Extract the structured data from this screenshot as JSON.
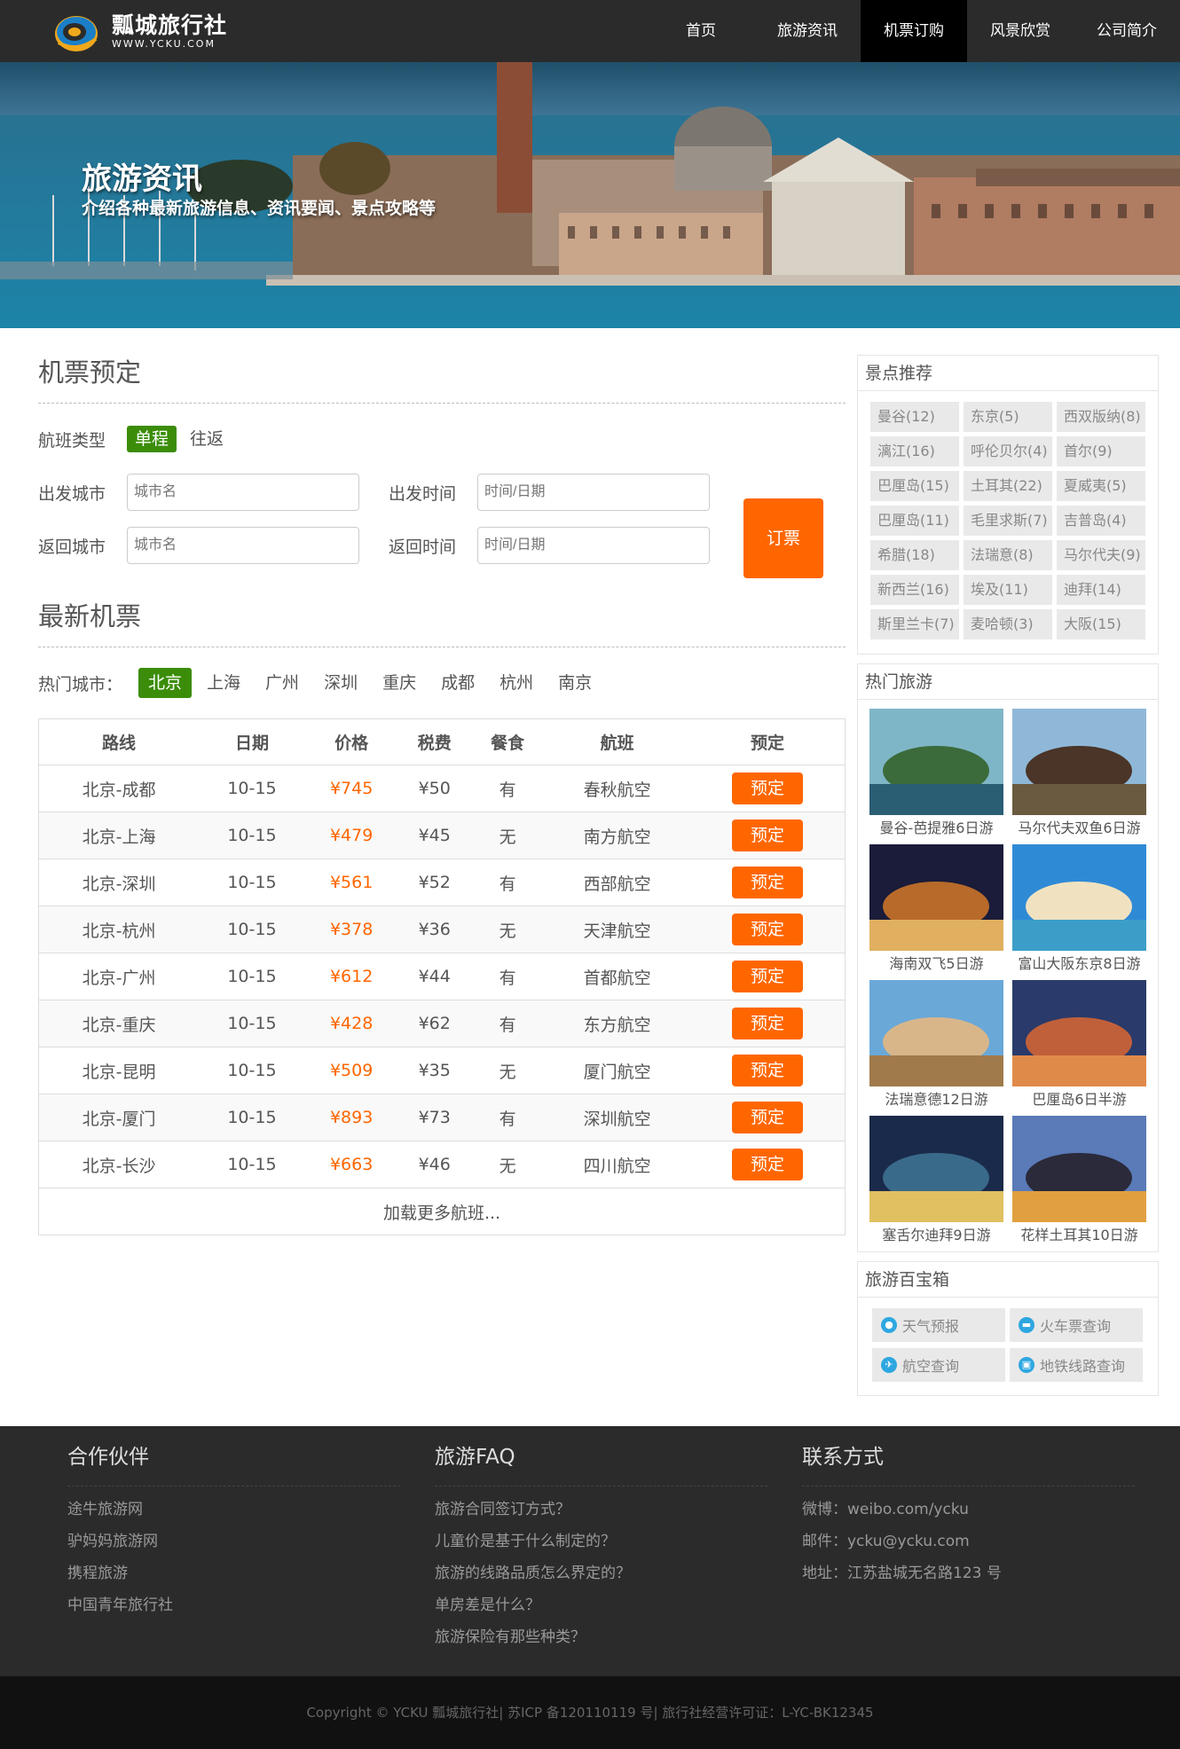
{
  "brand": {
    "name": "瓢城旅行社",
    "url": "WWW.YCKU.COM"
  },
  "nav": [
    {
      "label": "首页"
    },
    {
      "label": "旅游资讯"
    },
    {
      "label": "机票订购",
      "active": true
    },
    {
      "label": "风景欣赏"
    },
    {
      "label": "公司简介"
    }
  ],
  "banner": {
    "title": "旅游资讯",
    "subtitle": "介绍各种最新旅游信息、资讯要闻、景点攻略等"
  },
  "booking": {
    "title": "机票预定",
    "flight_type_label": "航班类型",
    "flight_types": [
      "单程",
      "往返"
    ],
    "depart_city_label": "出发城市",
    "depart_city_placeholder": "城市名",
    "depart_time_label": "出发时间",
    "depart_time_placeholder": "时间/日期",
    "return_city_label": "返回城市",
    "return_city_placeholder": "城市名",
    "return_time_label": "返回时间",
    "return_time_placeholder": "时间/日期",
    "submit_label": "订票"
  },
  "latest": {
    "title": "最新机票",
    "hot_label": "热门城市：",
    "cities": [
      "北京",
      "上海",
      "广州",
      "深圳",
      "重庆",
      "成都",
      "杭州",
      "南京"
    ],
    "columns": [
      "路线",
      "日期",
      "价格",
      "税费",
      "餐食",
      "航班",
      "预定"
    ],
    "rows": [
      {
        "route": "北京-成都",
        "date": "10-15",
        "price": "¥745",
        "tax": "¥50",
        "meal": "有",
        "airline": "春秋航空",
        "action": "预定"
      },
      {
        "route": "北京-上海",
        "date": "10-15",
        "price": "¥479",
        "tax": "¥45",
        "meal": "无",
        "airline": "南方航空",
        "action": "预定"
      },
      {
        "route": "北京-深圳",
        "date": "10-15",
        "price": "¥561",
        "tax": "¥52",
        "meal": "有",
        "airline": "西部航空",
        "action": "预定"
      },
      {
        "route": "北京-杭州",
        "date": "10-15",
        "price": "¥378",
        "tax": "¥36",
        "meal": "无",
        "airline": "天津航空",
        "action": "预定"
      },
      {
        "route": "北京-广州",
        "date": "10-15",
        "price": "¥612",
        "tax": "¥44",
        "meal": "有",
        "airline": "首都航空",
        "action": "预定"
      },
      {
        "route": "北京-重庆",
        "date": "10-15",
        "price": "¥428",
        "tax": "¥62",
        "meal": "有",
        "airline": "东方航空",
        "action": "预定"
      },
      {
        "route": "北京-昆明",
        "date": "10-15",
        "price": "¥509",
        "tax": "¥35",
        "meal": "无",
        "airline": "厦门航空",
        "action": "预定"
      },
      {
        "route": "北京-厦门",
        "date": "10-15",
        "price": "¥893",
        "tax": "¥73",
        "meal": "有",
        "airline": "深圳航空",
        "action": "预定"
      },
      {
        "route": "北京-长沙",
        "date": "10-15",
        "price": "¥663",
        "tax": "¥46",
        "meal": "无",
        "airline": "四川航空",
        "action": "预定"
      }
    ],
    "load_more": "加载更多航班..."
  },
  "sidebar": {
    "spots_title": "景点推荐",
    "spots": [
      "曼谷(12)",
      "东京(5)",
      "西双版纳(8)",
      "漓江(16)",
      "呼伦贝尔(4)",
      "首尔(9)",
      "巴厘岛(15)",
      "土耳其(22)",
      "夏威夷(5)",
      "巴厘岛(11)",
      "毛里求斯(7)",
      "吉普岛(4)",
      "希腊(18)",
      "法瑞意(8)",
      "马尔代夫(9)",
      "新西兰(16)",
      "埃及(11)",
      "迪拜(14)",
      "斯里兰卡(7)",
      "麦哈顿(3)",
      "大阪(15)"
    ],
    "tours_title": "热门旅游",
    "tours": [
      {
        "caption": "曼谷-芭提雅6日游",
        "icon": "bay-islands-photo"
      },
      {
        "caption": "马尔代夫双鱼6日游",
        "icon": "temple-gate-photo"
      },
      {
        "caption": "海南双飞5日游",
        "icon": "night-temple-photo"
      },
      {
        "caption": "富山大阪东京8日游",
        "icon": "beach-huts-photo"
      },
      {
        "caption": "法瑞意德12日游",
        "icon": "beach-hat-photo"
      },
      {
        "caption": "巴厘岛6日半游",
        "icon": "aqueduct-photo"
      },
      {
        "caption": "塞舌尔迪拜9日游",
        "icon": "harbor-night-photo"
      },
      {
        "caption": "花样土耳其10日游",
        "icon": "city-tower-photo"
      }
    ],
    "tools_title": "旅游百宝箱",
    "tools": [
      {
        "label": "天气预报",
        "icon": "location-pin-icon"
      },
      {
        "label": "火车票查询",
        "icon": "train-icon"
      },
      {
        "label": "航空查询",
        "icon": "plane-icon"
      },
      {
        "label": "地铁线路查询",
        "icon": "subway-icon"
      }
    ]
  },
  "footer": {
    "partners_title": "合作伙伴",
    "partners": [
      "途牛旅游网",
      "驴妈妈旅游网",
      "携程旅游",
      "中国青年旅行社"
    ],
    "faq_title": "旅游FAQ",
    "faq": [
      "旅游合同签订方式？",
      "儿童价是基于什么制定的？",
      "旅游的线路品质怎么界定的？",
      "单房差是什么？",
      "旅游保险有那些种类？"
    ],
    "contact_title": "联系方式",
    "contact": [
      "微博：weibo.com/ycku",
      "邮件：ycku@ycku.com",
      "地址：江苏盐城无名路123 号"
    ],
    "copyright": "Copyright © YCKU 瓢城旅行社| 苏ICP 备120110119 号| 旅行社经营许可证：L-YC-BK12345"
  }
}
